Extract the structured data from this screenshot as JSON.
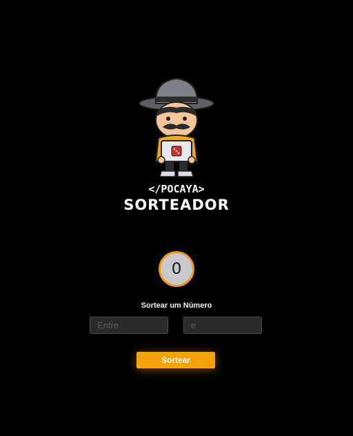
{
  "logo": {
    "tagline": "</POCAYA>",
    "brand": "SORTEADOR"
  },
  "result": {
    "value": "0"
  },
  "form": {
    "label": "Sortear um Número",
    "min_placeholder": "Entre",
    "max_placeholder": "e",
    "button_label": "Sortear"
  },
  "colors": {
    "background": "#000000",
    "accent": "#f5a10c",
    "circle_fill": "#c9c9cc"
  },
  "icons": [
    "mascot-logo",
    "dice-icon"
  ]
}
